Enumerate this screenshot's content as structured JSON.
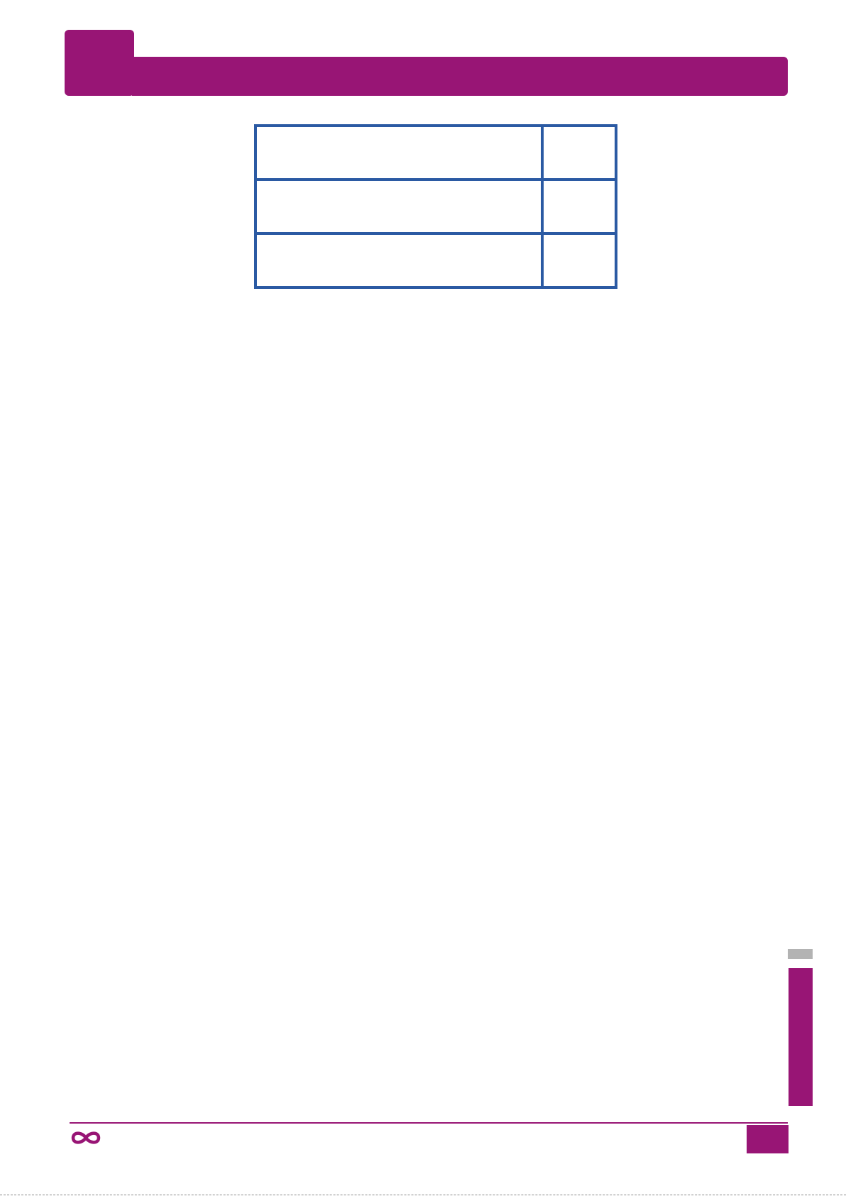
{
  "header": {
    "chapter_number": "",
    "title": ""
  },
  "table": {
    "rows": [
      {
        "label": "",
        "value": ""
      },
      {
        "label": "",
        "value": ""
      },
      {
        "label": "",
        "value": ""
      }
    ]
  },
  "footer": {
    "logo_icon": "infinity-icon",
    "page_number": ""
  },
  "colors": {
    "accent": "#981575",
    "table_border": "#2b5aa3",
    "side_tab_grey": "#b3b3b3"
  }
}
